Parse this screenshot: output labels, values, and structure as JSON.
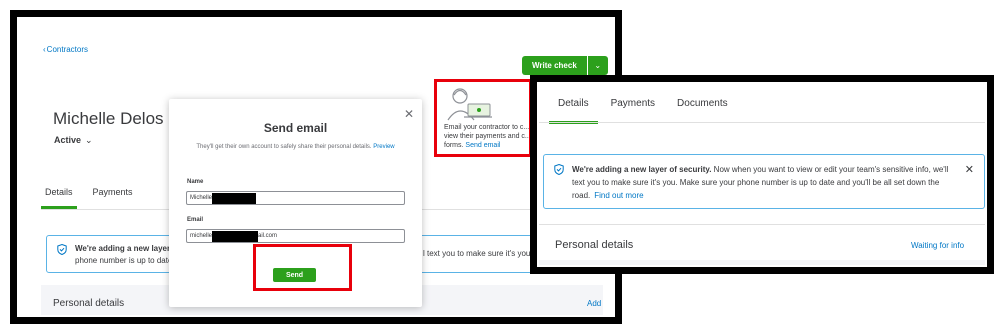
{
  "left_panel": {
    "back_link": "Contractors",
    "write_check_label": "Write check",
    "contact_name": "Michelle Delos I",
    "status_label": "Active",
    "tabs": [
      {
        "label": "Details",
        "active": true
      },
      {
        "label": "Payments",
        "active": false
      }
    ],
    "promo": {
      "text": "Email your contractor to c... view their payments and c... forms.",
      "link": "Send email"
    },
    "banner": {
      "bold": "We're adding a new layer of",
      "line2": "phone number is up to date",
      "right_fragment": "l text you to make sure it's you. M"
    },
    "personal_details_label": "Personal details",
    "add_link": "Add"
  },
  "modal": {
    "title": "Send email",
    "subtitle": "They'll get their own account to safely share their personal details.",
    "preview_link": "Preview",
    "name_label": "Name",
    "name_value_prefix": "Michelle",
    "email_label": "Email",
    "email_value_prefix": "michelle",
    "email_value_suffix": "ail.com",
    "send_label": "Send"
  },
  "right_panel": {
    "tabs": [
      {
        "label": "Details",
        "active": true
      },
      {
        "label": "Payments",
        "active": false
      },
      {
        "label": "Documents",
        "active": false
      }
    ],
    "banner": {
      "bold": "We're adding a new layer of security.",
      "text": " Now when you want to view or edit your team's sensitive info, we'll text you to make sure it's you. Make sure your phone number is up to date and you'll be all set down the road.",
      "link": "Find out more"
    },
    "personal_details_label": "Personal details",
    "waiting_link": "Waiting for info"
  },
  "colors": {
    "brand_green": "#2ca01c",
    "link_blue": "#0077c5",
    "highlight_red": "#e8000b",
    "info_border": "#5ab3e6"
  }
}
